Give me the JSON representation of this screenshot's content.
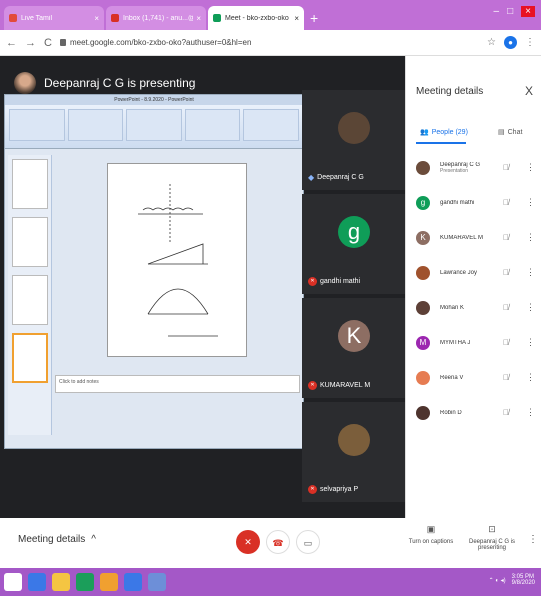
{
  "browser": {
    "tabs": [
      {
        "title": "Live Tamil",
        "close": "×",
        "color": "#e24a3b"
      },
      {
        "title": "Inbox (1,741) - anu...@gm",
        "close": "×",
        "color": "#d93025"
      },
      {
        "title": "Meet - bko-zxbo-oko",
        "close": "×",
        "color": "#0f9d58"
      }
    ],
    "new_tab": "+",
    "url": "meet.google.com/bko-zxbo-oko?authuser=0&hl=en"
  },
  "meet": {
    "presenting_banner": "Deepanraj C G is presenting",
    "ppt_title": "PowerPoint - 8.9.2020 - PowerPoint",
    "notes_placeholder": "Click to add notes",
    "tiles": [
      {
        "name": "Deepanraj C G",
        "initial": "",
        "color": "#5b4636",
        "mic": "on"
      },
      {
        "name": "gandhi mathi",
        "initial": "g",
        "color": "#0f9d58",
        "mic": "off"
      },
      {
        "name": "KUMARAVEL M",
        "initial": "K",
        "color": "#8d6e63",
        "mic": "off"
      },
      {
        "name": "selvapriya P",
        "initial": "",
        "color": "#7b5e3b",
        "mic": "off"
      }
    ]
  },
  "panel": {
    "title": "Meeting details",
    "close": "X",
    "tab_people": "People (29)",
    "tab_chat": "Chat",
    "people": [
      {
        "name": "Deepanraj C G",
        "sub": "Presentation",
        "initial": "",
        "color": "#6b4c3b"
      },
      {
        "name": "gandhi mathi",
        "sub": "",
        "initial": "g",
        "color": "#0f9d58"
      },
      {
        "name": "KUMARAVEL M",
        "sub": "",
        "initial": "K",
        "color": "#8d6e63"
      },
      {
        "name": "Lawrance Joy",
        "sub": "",
        "initial": "",
        "color": "#a0522d"
      },
      {
        "name": "Mohan K",
        "sub": "",
        "initial": "",
        "color": "#5d4037"
      },
      {
        "name": "MYMTHA J",
        "sub": "",
        "initial": "M",
        "color": "#9c27b0"
      },
      {
        "name": "Reena V",
        "sub": "",
        "initial": "",
        "color": "#e67c52"
      },
      {
        "name": "Robin D",
        "sub": "",
        "initial": "",
        "color": "#4e342e"
      }
    ]
  },
  "controls": {
    "meeting_details": "Meeting details",
    "captions": "Turn on captions",
    "presenting": "Deepanraj C G is presenting"
  },
  "taskbar": {
    "time": "3:05 PM",
    "date": "9/8/2020"
  }
}
